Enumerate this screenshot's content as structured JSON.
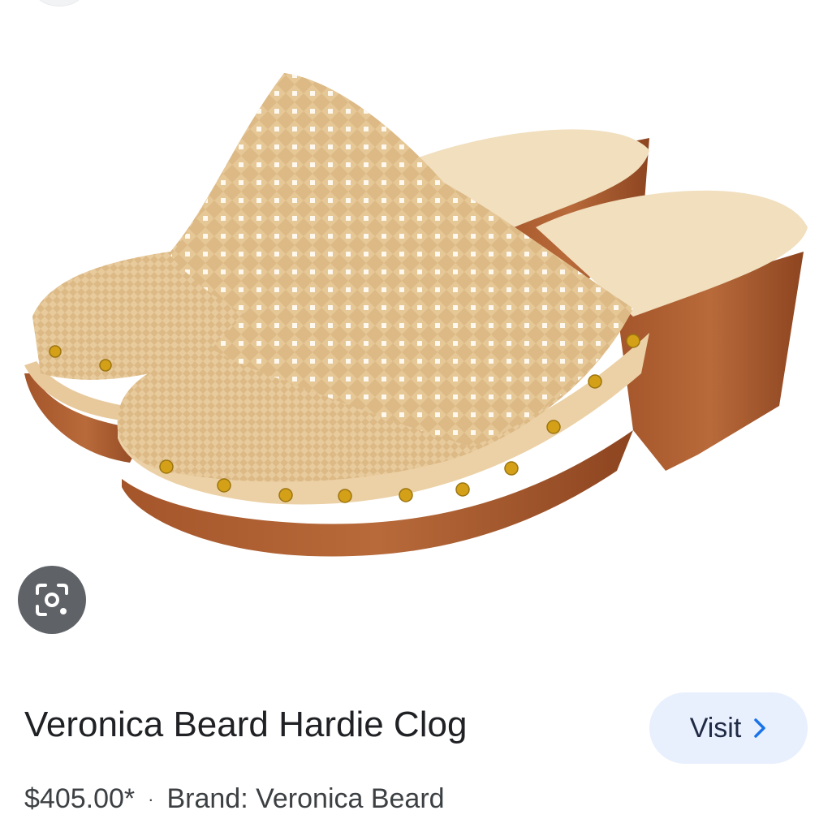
{
  "product": {
    "title": "Veronica Beard Hardie Clog",
    "price": "$405.00*",
    "separator": "·",
    "brand": "Brand: Veronica Beard"
  },
  "actions": {
    "visit_label": "Visit"
  },
  "icons": {
    "lens": "google-lens-icon",
    "visit_arrow": "chevron-right-icon"
  },
  "colors": {
    "visit_bg": "#e8f0fe",
    "visit_chevron": "#1a73e8",
    "lens_bg": "#5f6368"
  }
}
